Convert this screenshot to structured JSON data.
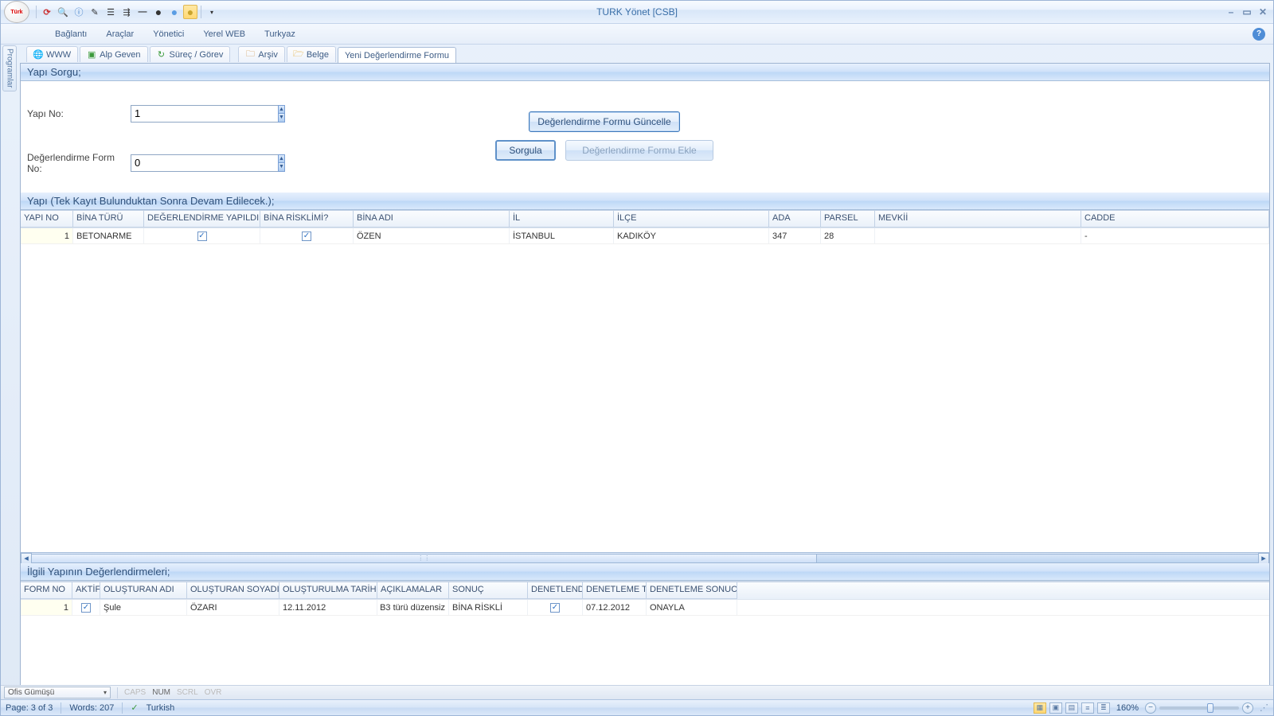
{
  "window": {
    "title": "TURK Yönet [CSB]"
  },
  "logo_text": "Türk",
  "menubar": [
    "Bağlantı",
    "Araçlar",
    "Yönetici",
    "Yerel WEB",
    "Turkyaz"
  ],
  "sidebar_tab": "Programlar",
  "tabs": [
    {
      "label": "WWW"
    },
    {
      "label": "Alp Geven"
    },
    {
      "label": "Süreç / Görev"
    },
    {
      "label": "Arşiv"
    },
    {
      "label": "Belge"
    },
    {
      "label": "Yeni Değerlendirme Formu"
    }
  ],
  "form": {
    "title": "Yapı Sorgu;",
    "yapi_no_label": "Yapı No:",
    "yapi_no_value": "1",
    "form_no_label": "Değerlendirme Form No:",
    "form_no_value": "0",
    "btn_guncelle": "Değerlendirme Formu Güncelle",
    "btn_sorgula": "Sorgula",
    "btn_ekle": "Değerlendirme Formu Ekle"
  },
  "grid1": {
    "title": "Yapı (Tek Kayıt Bulunduktan Sonra Devam Edilecek.);",
    "headers": [
      "YAPI NO",
      "BİNA TÜRÜ",
      "DEĞERLENDİRME YAPILDIMI",
      "BİNA RİSKLİMİ?",
      "BİNA ADI",
      "İL",
      "İLÇE",
      "ADA",
      "PARSEL",
      "MEVKİİ",
      "CADDE"
    ],
    "row": {
      "yapi_no": "1",
      "bina_turu": "BETONARME",
      "deg": true,
      "risk": true,
      "bina_adi": "ÖZEN",
      "il": "İSTANBUL",
      "ilce": "KADIKÖY",
      "ada": "347",
      "parsel": "28",
      "mevkii": "",
      "cadde": "-"
    }
  },
  "grid2": {
    "title": "İlgili Yapının Değerlendirmeleri;",
    "headers": [
      "FORM NO",
      "AKTİF",
      "OLUŞTURAN ADI",
      "OLUŞTURAN SOYADI",
      "OLUŞTURULMA TARİHİ",
      "AÇIKLAMALAR",
      "SONUÇ",
      "DENETLENDİ",
      "DENETLEME TA",
      "DENETLEME SONUCU"
    ],
    "row": {
      "form_no": "1",
      "aktif": true,
      "ad": "Şule",
      "soyad": "ÖZARI",
      "tarih": "12.11.2012",
      "acik": "B3 türü düzensiz",
      "sonuc": "BİNA RİSKLİ",
      "denet": true,
      "dtarih": "07.12.2012",
      "dsonuc": "ONAYLA"
    }
  },
  "status1": {
    "theme": "Ofis Gümüşü",
    "caps": "CAPS",
    "num": "NUM",
    "scrl": "SCRL",
    "ovr": "OVR"
  },
  "status2": {
    "page": "Page: 3 of 3",
    "words": "Words: 207",
    "lang": "Turkish",
    "zoom": "160%"
  }
}
